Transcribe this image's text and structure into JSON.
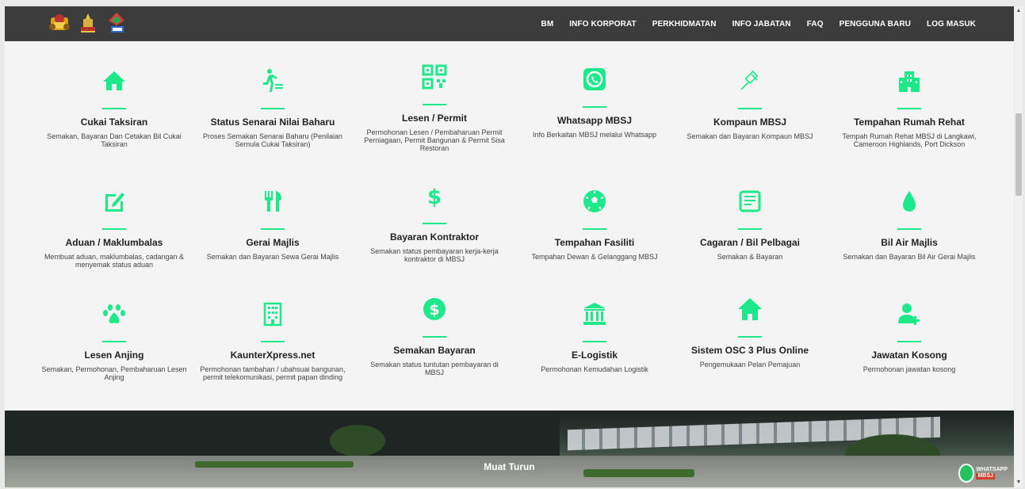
{
  "nav": {
    "links": [
      "BM",
      "INFO KORPORAT",
      "PERKHIDMATAN",
      "INFO JABATAN",
      "FAQ",
      "PENGGUNA BARU",
      "LOG MASUK"
    ]
  },
  "colors": {
    "accent": "#1de98b",
    "nav_bg": "#3c3c3c",
    "page_bg": "#f4f4f4"
  },
  "services": [
    {
      "icon": "home-icon",
      "title": "Cukai Taksiran",
      "desc": "Semakan, Bayaran Dan Cetakan Bil Cukai Taksiran"
    },
    {
      "icon": "walking-person-icon",
      "title": "Status Senarai Nilai Baharu",
      "desc": "Proses Semakan Senarai Baharu (Penilaian Semula Cukai Taksiran)"
    },
    {
      "icon": "qr-code-icon",
      "title": "Lesen / Permit",
      "desc": "Permohonan Lesen / Pembaharuan Permit Perniagaan, Permit Bangunan & Permit Sisa Restoran"
    },
    {
      "icon": "whatsapp-icon",
      "title": "Whatsapp MBSJ",
      "desc": "Info Berkaitan MBSJ melalui Whatsapp"
    },
    {
      "icon": "gavel-icon",
      "title": "Kompaun MBSJ",
      "desc": "Semakan dan Bayaran Kompaun MBSJ"
    },
    {
      "icon": "building-icon",
      "title": "Tempahan Rumah Rehat",
      "desc": "Tempah Rumah Rehat MBSJ di Langkawi, Cameroon Highlands, Port Dickson"
    },
    {
      "icon": "edit-icon",
      "title": "Aduan / Maklumbalas",
      "desc": "Membuat aduan, maklumbalas, cadangan & menyemak status aduan"
    },
    {
      "icon": "cutlery-icon",
      "title": "Gerai Majlis",
      "desc": "Semakan dan Bayaran Sewa Gerai Majlis"
    },
    {
      "icon": "dollar-icon",
      "title": "Bayaran Kontraktor",
      "desc": "Semakan status pembayaran kerja-kerja kontraktor di MBSJ"
    },
    {
      "icon": "football-icon",
      "title": "Tempahan Fasiliti",
      "desc": "Tempahan Dewan & Gelanggang MBSJ"
    },
    {
      "icon": "bill-icon",
      "title": "Cagaran / Bil Pelbagai",
      "desc": "Semakan & Bayaran"
    },
    {
      "icon": "water-drop-icon",
      "title": "Bil Air Majlis",
      "desc": "Semakan dan Bayaran Bil Air Gerai Majlis"
    },
    {
      "icon": "paw-icon",
      "title": "Lesen Anjing",
      "desc": "Semakan, Permohonan, Pembaharuan Lesen Anjing"
    },
    {
      "icon": "office-building-icon",
      "title": "KaunterXpress.net",
      "desc": "Permohonan tambahan / ubahsuai bangunan, permit telekomunikasi, permit papan dinding"
    },
    {
      "icon": "dollar-circle-icon",
      "title": "Semakan Bayaran",
      "desc": "Semakan status tuntutan pembayaran di MBSJ"
    },
    {
      "icon": "institution-icon",
      "title": "E-Logistik",
      "desc": "Permohonan Kemudahan Logistik"
    },
    {
      "icon": "house-icon",
      "title": "Sistem OSC 3 Plus Online",
      "desc": "Pengemukaan Pelan Pemajuan"
    },
    {
      "icon": "add-user-icon",
      "title": "Jawatan Kosong",
      "desc": "Permohonan jawatan kosong"
    }
  ],
  "banner": {
    "label": "Muat Turun",
    "whatsapp_badge": {
      "line1": "WHATSAPP",
      "line2": "MBSJ"
    }
  }
}
